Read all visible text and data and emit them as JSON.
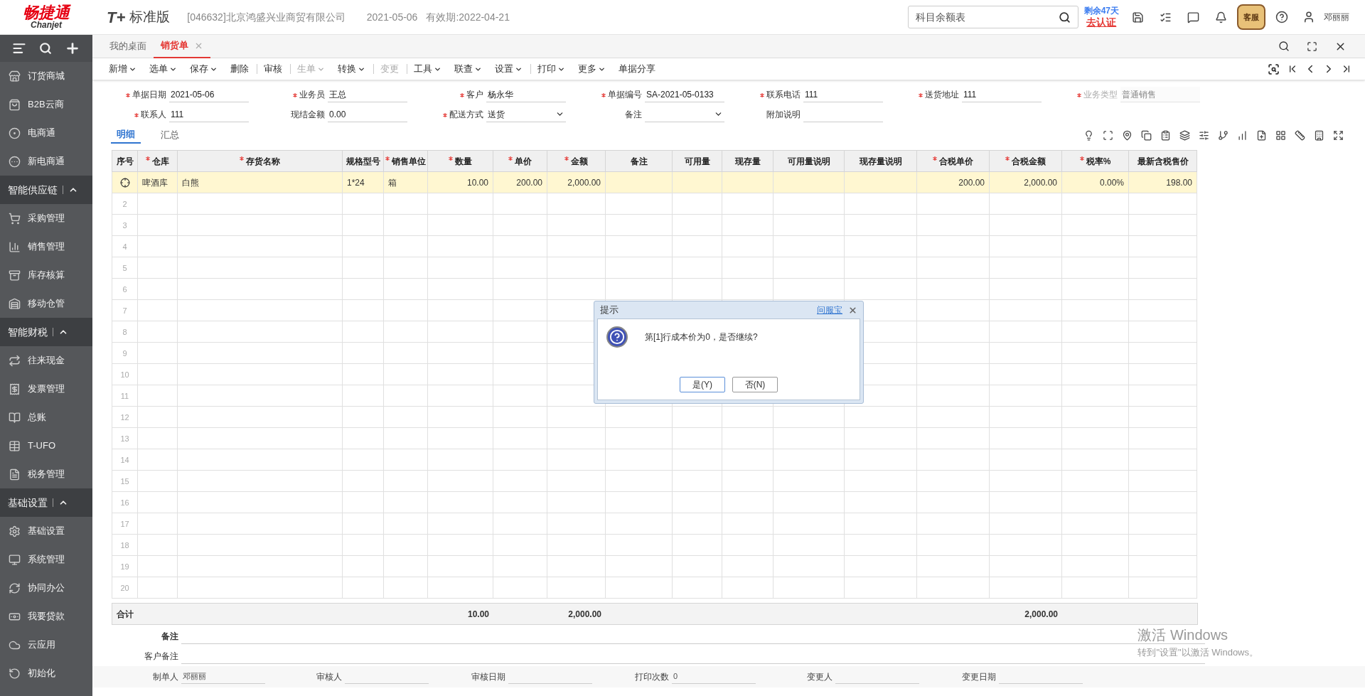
{
  "header": {
    "logo_cn": "畅捷通",
    "logo_en": "Chanjet",
    "product_mark": "T+",
    "product_name": "标准版",
    "company": "[046632]北京鸿盛兴业商贸有限公司",
    "date": "2021-05-06",
    "validity": "有效期:2022-04-21",
    "search": {
      "value": "科目余额表"
    },
    "trial_days": "剩余47天",
    "certify_link": "去认证",
    "service_badge": "客服",
    "user": "邓丽丽"
  },
  "sidebar": {
    "sections": [
      {
        "items": [
          {
            "label": "订货商城"
          },
          {
            "label": "B2B云商"
          },
          {
            "label": "电商通"
          },
          {
            "label": "新电商通"
          }
        ]
      },
      {
        "title": "智能供应链",
        "expanded": true,
        "items": [
          {
            "label": "采购管理"
          },
          {
            "label": "销售管理"
          },
          {
            "label": "库存核算"
          },
          {
            "label": "移动仓管"
          }
        ]
      },
      {
        "title": "智能财税",
        "expanded": true,
        "items": [
          {
            "label": "往来现金"
          },
          {
            "label": "发票管理"
          },
          {
            "label": "总账"
          },
          {
            "label": "T-UFO"
          },
          {
            "label": "税务管理"
          }
        ]
      },
      {
        "title": "基础设置",
        "expanded": true,
        "items": [
          {
            "label": "基础设置"
          },
          {
            "label": "系统管理"
          },
          {
            "label": "协同办公"
          },
          {
            "label": "我要贷款"
          },
          {
            "label": "云应用"
          },
          {
            "label": "初始化"
          }
        ]
      }
    ]
  },
  "tabs": [
    {
      "label": "我的桌面",
      "selected": false,
      "closable": false
    },
    {
      "label": "销货单",
      "selected": true,
      "closable": true
    }
  ],
  "toolbar": [
    {
      "label": "新增",
      "dropdown": true,
      "disabled": false,
      "separator_before": false
    },
    {
      "label": "选单",
      "dropdown": true,
      "disabled": false,
      "separator_before": false
    },
    {
      "label": "保存",
      "dropdown": true,
      "disabled": false,
      "separator_before": false
    },
    {
      "label": "删除",
      "dropdown": false,
      "disabled": false,
      "separator_before": false
    },
    {
      "label": "审核",
      "dropdown": false,
      "disabled": false,
      "separator_before": true
    },
    {
      "label": "生单",
      "dropdown": true,
      "disabled": true,
      "separator_before": true
    },
    {
      "label": "转换",
      "dropdown": true,
      "disabled": false,
      "separator_before": false
    },
    {
      "label": "变更",
      "dropdown": false,
      "disabled": true,
      "separator_before": true
    },
    {
      "label": "工具",
      "dropdown": true,
      "disabled": false,
      "separator_before": true
    },
    {
      "label": "联查",
      "dropdown": true,
      "disabled": false,
      "separator_before": false
    },
    {
      "label": "设置",
      "dropdown": true,
      "disabled": false,
      "separator_before": false
    },
    {
      "label": "打印",
      "dropdown": true,
      "disabled": false,
      "separator_before": true
    },
    {
      "label": "更多",
      "dropdown": true,
      "disabled": false,
      "separator_before": false
    },
    {
      "label": "单据分享",
      "dropdown": false,
      "disabled": false,
      "separator_before": false
    }
  ],
  "form": {
    "rows": [
      [
        {
          "label": "单据日期",
          "value": "2021-05-06",
          "required": true,
          "kind": "text",
          "disabled": false
        },
        {
          "label": "业务员",
          "value": "王总",
          "required": true,
          "kind": "text",
          "disabled": false
        },
        {
          "label": "客户",
          "value": "杨永华",
          "required": true,
          "kind": "text",
          "disabled": false
        },
        {
          "label": "单据编号",
          "value": "SA-2021-05-0133",
          "required": true,
          "kind": "text",
          "disabled": false
        },
        {
          "label": "联系电话",
          "value": "111",
          "required": true,
          "kind": "text",
          "disabled": false
        },
        {
          "label": "送货地址",
          "value": "111",
          "required": true,
          "kind": "text",
          "disabled": false
        },
        {
          "label": "业务类型",
          "value": "普通销售",
          "required": true,
          "kind": "text",
          "disabled": true
        }
      ],
      [
        {
          "label": "联系人",
          "value": "111",
          "required": true,
          "kind": "text",
          "disabled": false
        },
        {
          "label": "现结金额",
          "value": "0.00",
          "required": false,
          "kind": "text",
          "disabled": false
        },
        {
          "label": "配送方式",
          "value": "送货",
          "required": true,
          "kind": "select",
          "disabled": false
        },
        {
          "label": "备注",
          "required": false,
          "kind": "select",
          "disabled": false
        },
        {
          "label": "附加说明",
          "required": false,
          "kind": "text",
          "disabled": false
        }
      ]
    ]
  },
  "detail_tabs": [
    {
      "label": "明细",
      "selected": true
    },
    {
      "label": "汇总",
      "selected": false
    }
  ],
  "table": {
    "columns": [
      {
        "label": "序号",
        "required": false
      },
      {
        "label": "仓库",
        "required": true
      },
      {
        "label": "存货名称",
        "required": true
      },
      {
        "label": "规格型号",
        "required": false
      },
      {
        "label": "销售单位",
        "required": true
      },
      {
        "label": "数量",
        "required": true
      },
      {
        "label": "单价",
        "required": true
      },
      {
        "label": "金额",
        "required": true
      },
      {
        "label": "备注",
        "required": false
      },
      {
        "label": "可用量",
        "required": false
      },
      {
        "label": "现存量",
        "required": false
      },
      {
        "label": "可用量说明",
        "required": false
      },
      {
        "label": "现存量说明",
        "required": false
      },
      {
        "label": "合税单价",
        "required": true
      },
      {
        "label": "合税金额",
        "required": true
      },
      {
        "label": "税率%",
        "required": true
      },
      {
        "label": "最新含税售价",
        "required": false
      }
    ],
    "rows": [
      {
        "selected": true,
        "cells": [
          null,
          "啤酒库",
          "白熊",
          "1*24",
          "箱",
          "10.00",
          "200.00",
          "2,000.00",
          null,
          null,
          null,
          null,
          null,
          "200.00",
          "2,000.00",
          "0.00%",
          "198.00"
        ]
      },
      {
        "no": "2",
        "selected": false
      },
      {
        "no": "3",
        "selected": false
      },
      {
        "no": "4",
        "selected": false
      },
      {
        "no": "5",
        "selected": false
      },
      {
        "no": "6",
        "selected": false
      },
      {
        "no": "7",
        "selected": false
      },
      {
        "no": "8",
        "selected": false
      },
      {
        "no": "9",
        "selected": false
      },
      {
        "no": "10",
        "selected": false
      },
      {
        "no": "11",
        "selected": false
      },
      {
        "no": "12",
        "selected": false
      },
      {
        "no": "13",
        "selected": false
      },
      {
        "no": "14",
        "selected": false
      },
      {
        "no": "15",
        "selected": false
      },
      {
        "no": "16",
        "selected": false
      },
      {
        "no": "17",
        "selected": false
      },
      {
        "no": "18",
        "selected": false
      },
      {
        "no": "19",
        "selected": false
      },
      {
        "no": "20",
        "selected": false
      }
    ],
    "totals": {
      "label": "合计",
      "cells": [
        null,
        null,
        null,
        null,
        "10.00",
        null,
        "2,000.00",
        null,
        null,
        null,
        null,
        null,
        null,
        "2,000.00",
        null,
        null
      ]
    }
  },
  "remarks": [
    {
      "label": "备注",
      "bold": true
    },
    {
      "label": "客户备注",
      "bold": false
    }
  ],
  "footer_fields": [
    {
      "label": "制单人",
      "value": "邓丽丽"
    },
    {
      "label": "审核人"
    },
    {
      "label": "审核日期"
    },
    {
      "label": "打印次数",
      "value": "0"
    },
    {
      "label": "变更人"
    },
    {
      "label": "变更日期"
    }
  ],
  "dialog": {
    "title": "提示",
    "help_link": "问服宝",
    "message": "第[1]行成本价为0，是否继续?",
    "buttons": [
      {
        "label": "是(Y)",
        "selected": true
      },
      {
        "label": "否(N)",
        "selected": false
      }
    ]
  },
  "activation_notice": {
    "title": "激活 Windows",
    "text": "转到\"设置\"以激活 Windows。"
  }
}
